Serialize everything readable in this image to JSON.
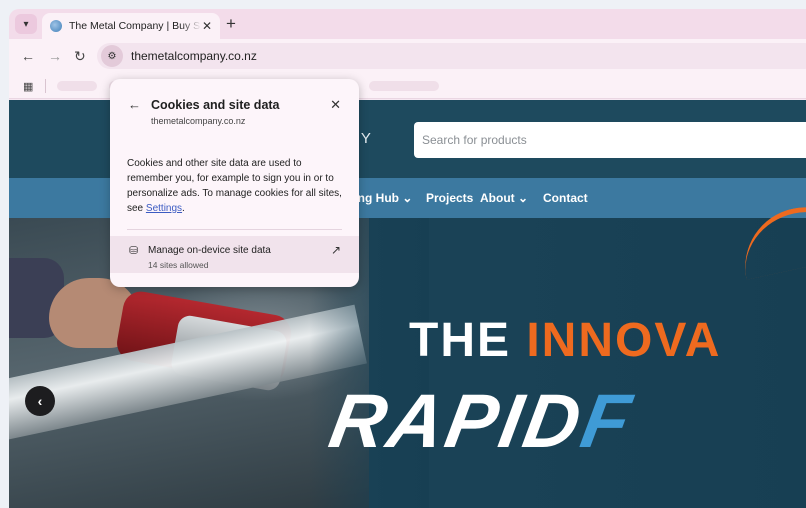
{
  "browser": {
    "tab": {
      "title": "The Metal Company | Buy Stainl"
    },
    "new_tab_label": "+",
    "url": "themetalcompany.co.nz"
  },
  "site": {
    "logo_partial": "NY",
    "search_placeholder": "Search for products",
    "nav": {
      "learning_hub": "ning Hub",
      "projects": "Projects",
      "about": "About",
      "contact": "Contact"
    },
    "hero": {
      "line1_a": "THE ",
      "line1_b": "INNOVA",
      "line2_a": "RAPID",
      "line2_b": "F"
    },
    "colors": {
      "accent_orange": "#ee6a1f",
      "accent_blue": "#3f9bd6",
      "navbar": "#3c79a0",
      "header": "#1e4a5e"
    }
  },
  "popup": {
    "title": "Cookies and site data",
    "subtitle": "themetalcompany.co.nz",
    "body": "Cookies and other site data are used to remember you, for example to sign you in or to personalize ads. To manage cookies for all sites, see ",
    "settings_link": "Settings",
    "body_end": ".",
    "manage_title": "Manage on-device site data",
    "manage_sub": "14 sites allowed"
  },
  "icons": {
    "tab_menu": "chevron-down-icon",
    "back": "arrow-left-icon",
    "forward": "arrow-right-icon",
    "reload": "reload-icon",
    "site_info": "tune-icon",
    "apps": "apps-grid-icon",
    "close": "close-icon",
    "database": "database-icon",
    "external": "open-in-new-icon",
    "carousel_prev": "chevron-left-icon"
  }
}
